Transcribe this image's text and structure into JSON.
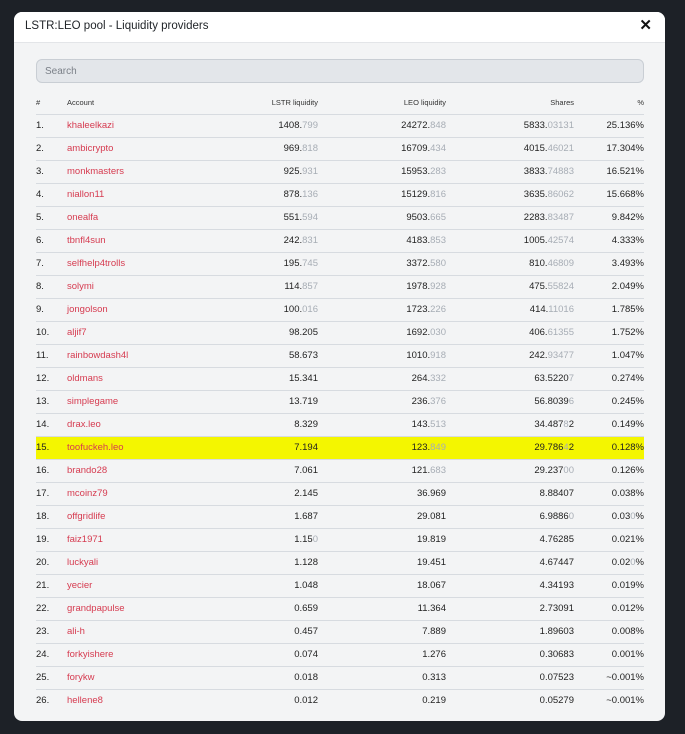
{
  "modal": {
    "title": "LSTR:LEO pool - Liquidity providers",
    "close_symbol": "✕"
  },
  "search": {
    "placeholder": "Search"
  },
  "table": {
    "headers": {
      "index": "#",
      "account": "Account",
      "lstr": "LSTR liquidity",
      "leo": "LEO liquidity",
      "shares": "Shares",
      "percent": "%"
    },
    "rows": [
      {
        "index": "1.",
        "account": "khaleelkazi",
        "lstr": [
          "1408.",
          "799",
          ""
        ],
        "leo": [
          "24272.",
          "848",
          ""
        ],
        "shares": [
          "5833.",
          "03131",
          ""
        ],
        "percent": [
          "25.136%",
          "",
          ""
        ],
        "highlight": false
      },
      {
        "index": "2.",
        "account": "ambicrypto",
        "lstr": [
          "969.",
          "818",
          ""
        ],
        "leo": [
          "16709.",
          "434",
          ""
        ],
        "shares": [
          "4015.",
          "46021",
          ""
        ],
        "percent": [
          "17.304%",
          "",
          ""
        ],
        "highlight": false
      },
      {
        "index": "3.",
        "account": "monkmasters",
        "lstr": [
          "925.",
          "931",
          ""
        ],
        "leo": [
          "15953.",
          "283",
          ""
        ],
        "shares": [
          "3833.",
          "74883",
          ""
        ],
        "percent": [
          "16.521%",
          "",
          ""
        ],
        "highlight": false
      },
      {
        "index": "4.",
        "account": "niallon11",
        "lstr": [
          "878.",
          "136",
          ""
        ],
        "leo": [
          "15129.",
          "816",
          ""
        ],
        "shares": [
          "3635.",
          "86062",
          ""
        ],
        "percent": [
          "15.668%",
          "",
          ""
        ],
        "highlight": false
      },
      {
        "index": "5.",
        "account": "onealfa",
        "lstr": [
          "551.",
          "594",
          ""
        ],
        "leo": [
          "9503.",
          "665",
          ""
        ],
        "shares": [
          "2283.",
          "83487",
          ""
        ],
        "percent": [
          "9.842%",
          "",
          ""
        ],
        "highlight": false
      },
      {
        "index": "6.",
        "account": "tbnfl4sun",
        "lstr": [
          "242.",
          "831",
          ""
        ],
        "leo": [
          "4183.",
          "853",
          ""
        ],
        "shares": [
          "1005.",
          "42574",
          ""
        ],
        "percent": [
          "4.333%",
          "",
          ""
        ],
        "highlight": false
      },
      {
        "index": "7.",
        "account": "selfhelp4trolls",
        "lstr": [
          "195.",
          "745",
          ""
        ],
        "leo": [
          "3372.",
          "580",
          ""
        ],
        "shares": [
          "810.",
          "46809",
          ""
        ],
        "percent": [
          "3.493%",
          "",
          ""
        ],
        "highlight": false
      },
      {
        "index": "8.",
        "account": "solymi",
        "lstr": [
          "114.",
          "857",
          ""
        ],
        "leo": [
          "1978.",
          "928",
          ""
        ],
        "shares": [
          "475.",
          "55824",
          ""
        ],
        "percent": [
          "2.049%",
          "",
          ""
        ],
        "highlight": false
      },
      {
        "index": "9.",
        "account": "jongolson",
        "lstr": [
          "100.",
          "016",
          ""
        ],
        "leo": [
          "1723.",
          "226",
          ""
        ],
        "shares": [
          "414.",
          "11016",
          ""
        ],
        "percent": [
          "1.785%",
          "",
          ""
        ],
        "highlight": false
      },
      {
        "index": "10.",
        "account": "aljif7",
        "lstr": [
          "98.205",
          "",
          ""
        ],
        "leo": [
          "1692.",
          "030",
          ""
        ],
        "shares": [
          "406.",
          "61355",
          ""
        ],
        "percent": [
          "1.752%",
          "",
          ""
        ],
        "highlight": false
      },
      {
        "index": "11.",
        "account": "rainbowdash4l",
        "lstr": [
          "58.673",
          "",
          ""
        ],
        "leo": [
          "1010.",
          "918",
          ""
        ],
        "shares": [
          "242.",
          "93477",
          ""
        ],
        "percent": [
          "1.047%",
          "",
          ""
        ],
        "highlight": false
      },
      {
        "index": "12.",
        "account": "oldmans",
        "lstr": [
          "15.341",
          "",
          ""
        ],
        "leo": [
          "264.",
          "332",
          ""
        ],
        "shares": [
          "63.5220",
          "7",
          ""
        ],
        "percent": [
          "0.274%",
          "",
          ""
        ],
        "highlight": false
      },
      {
        "index": "13.",
        "account": "simplegame",
        "lstr": [
          "13.719",
          "",
          ""
        ],
        "leo": [
          "236.",
          "376",
          ""
        ],
        "shares": [
          "56.8039",
          "6",
          ""
        ],
        "percent": [
          "0.245%",
          "",
          ""
        ],
        "highlight": false
      },
      {
        "index": "14.",
        "account": "drax.leo",
        "lstr": [
          "8.329",
          "",
          ""
        ],
        "leo": [
          "143.",
          "513",
          ""
        ],
        "shares": [
          "34.487",
          "8",
          "2"
        ],
        "percent": [
          "0.149%",
          "",
          ""
        ],
        "highlight": false
      },
      {
        "index": "15.",
        "account": "toofuckeh.leo",
        "lstr": [
          "7.194",
          "",
          ""
        ],
        "leo": [
          "123.",
          "849",
          ""
        ],
        "shares": [
          "29.786",
          "4",
          "2"
        ],
        "percent": [
          "0.128%",
          "",
          ""
        ],
        "highlight": true
      },
      {
        "index": "16.",
        "account": "brando28",
        "lstr": [
          "7.061",
          "",
          ""
        ],
        "leo": [
          "121.",
          "683",
          ""
        ],
        "shares": [
          "29.237",
          "00",
          ""
        ],
        "percent": [
          "0.126%",
          "",
          ""
        ],
        "highlight": false
      },
      {
        "index": "17.",
        "account": "mcoinz79",
        "lstr": [
          "2.145",
          "",
          ""
        ],
        "leo": [
          "36.969",
          "",
          ""
        ],
        "shares": [
          "8.88407",
          "",
          ""
        ],
        "percent": [
          "0.038%",
          "",
          ""
        ],
        "highlight": false
      },
      {
        "index": "18.",
        "account": "offgridlife",
        "lstr": [
          "1.687",
          "",
          ""
        ],
        "leo": [
          "29.081",
          "",
          ""
        ],
        "shares": [
          "6.9886",
          "0",
          ""
        ],
        "percent": [
          "0.03",
          "0",
          "%"
        ],
        "highlight": false
      },
      {
        "index": "19.",
        "account": "faiz1971",
        "lstr": [
          "1.15",
          "0",
          ""
        ],
        "leo": [
          "19.819",
          "",
          ""
        ],
        "shares": [
          "4.76285",
          "",
          ""
        ],
        "percent": [
          "0.021%",
          "",
          ""
        ],
        "highlight": false
      },
      {
        "index": "20.",
        "account": "luckyali",
        "lstr": [
          "1.128",
          "",
          ""
        ],
        "leo": [
          "19.451",
          "",
          ""
        ],
        "shares": [
          "4.67447",
          "",
          ""
        ],
        "percent": [
          "0.02",
          "0",
          "%"
        ],
        "highlight": false
      },
      {
        "index": "21.",
        "account": "yecier",
        "lstr": [
          "1.048",
          "",
          ""
        ],
        "leo": [
          "18.067",
          "",
          ""
        ],
        "shares": [
          "4.34193",
          "",
          ""
        ],
        "percent": [
          "0.019%",
          "",
          ""
        ],
        "highlight": false
      },
      {
        "index": "22.",
        "account": "grandpapulse",
        "lstr": [
          "0.659",
          "",
          ""
        ],
        "leo": [
          "11.364",
          "",
          ""
        ],
        "shares": [
          "2.73091",
          "",
          ""
        ],
        "percent": [
          "0.012%",
          "",
          ""
        ],
        "highlight": false
      },
      {
        "index": "23.",
        "account": "ali-h",
        "lstr": [
          "0.457",
          "",
          ""
        ],
        "leo": [
          "7.889",
          "",
          ""
        ],
        "shares": [
          "1.89603",
          "",
          ""
        ],
        "percent": [
          "0.008%",
          "",
          ""
        ],
        "highlight": false
      },
      {
        "index": "24.",
        "account": "forkyishere",
        "lstr": [
          "0.074",
          "",
          ""
        ],
        "leo": [
          "1.276",
          "",
          ""
        ],
        "shares": [
          "0.30683",
          "",
          ""
        ],
        "percent": [
          "0.001%",
          "",
          ""
        ],
        "highlight": false
      },
      {
        "index": "25.",
        "account": "forykw",
        "lstr": [
          "0.018",
          "",
          ""
        ],
        "leo": [
          "0.313",
          "",
          ""
        ],
        "shares": [
          "0.07523",
          "",
          ""
        ],
        "percent": [
          "~0.001%",
          "",
          ""
        ],
        "highlight": false
      },
      {
        "index": "26.",
        "account": "hellene8",
        "lstr": [
          "0.012",
          "",
          ""
        ],
        "leo": [
          "0.219",
          "",
          ""
        ],
        "shares": [
          "0.05279",
          "",
          ""
        ],
        "percent": [
          "~0.001%",
          "",
          ""
        ],
        "highlight": false
      }
    ]
  }
}
